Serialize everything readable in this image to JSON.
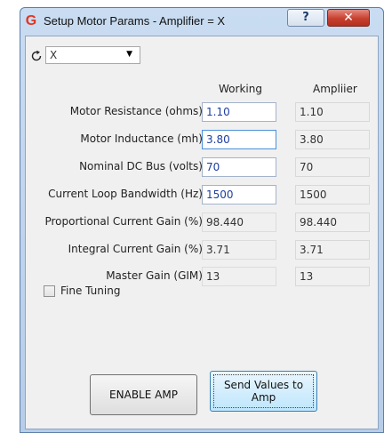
{
  "window": {
    "title": "Setup Motor Params - Amplifier = X",
    "logo_letter": "G",
    "help_label": "?",
    "close_label": "✕"
  },
  "amplifier_select": {
    "value": "X"
  },
  "columns": {
    "working": "Working",
    "amplifier": "Ampliier"
  },
  "rows": [
    {
      "label": "Motor Resistance (ohms):",
      "working": "1.10",
      "amplifier": "1.10",
      "editable": true
    },
    {
      "label": "Motor Inductance (mh):",
      "working": "3.80",
      "amplifier": "3.80",
      "editable": true
    },
    {
      "label": "Nominal DC Bus (volts):",
      "working": "70",
      "amplifier": "70",
      "editable": true
    },
    {
      "label": "Current Loop Bandwidth (Hz):",
      "working": "1500",
      "amplifier": "1500",
      "editable": true
    },
    {
      "label": "Proportional Current Gain (%):",
      "working": "98.440",
      "amplifier": "98.440",
      "editable": false
    },
    {
      "label": "Integral Current Gain (%):",
      "working": "3.71",
      "amplifier": "3.71",
      "editable": false
    },
    {
      "label": "Master Gain (GIM):",
      "working": "13",
      "amplifier": "13",
      "editable": false
    }
  ],
  "fine_tuning": {
    "label": "Fine Tuning",
    "checked": false
  },
  "buttons": {
    "enable_amp": "ENABLE AMP",
    "send_values_line1": "Send Values to",
    "send_values_line2": "Amp"
  },
  "colors": {
    "logo": "#e43320",
    "editable_text": "#1c3fa0",
    "close_button": "#c7402f"
  }
}
